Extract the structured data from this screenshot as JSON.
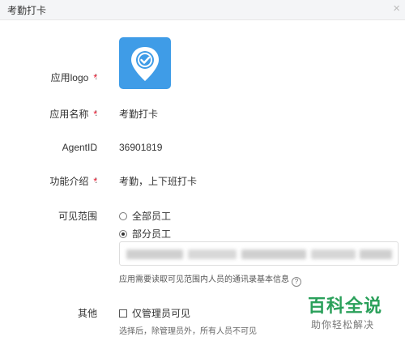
{
  "dialog": {
    "title": "考勤打卡",
    "close": "×"
  },
  "form": {
    "logo": {
      "label": "应用logo",
      "required": "*",
      "colon": ":"
    },
    "name": {
      "label": "应用名称",
      "required": "*",
      "colon": ":",
      "value": "考勤打卡"
    },
    "agent": {
      "label": "AgentID",
      "colon": ":",
      "value": "36901819"
    },
    "intro": {
      "label": "功能介绍",
      "required": "*",
      "colon": ":",
      "value": "考勤，上下班打卡"
    },
    "visible": {
      "label": "可见范围",
      "colon": ":",
      "options": [
        {
          "label": "全部员工",
          "selected": false
        },
        {
          "label": "部分员工",
          "selected": true
        }
      ],
      "hint": "应用需要读取可见范围内人员的通讯录基本信息",
      "hint_icon": "?"
    },
    "other": {
      "label": "其他",
      "colon": ":",
      "checkbox_label": "仅管理员可见",
      "checked": false,
      "hint": "选择后，除管理员外，所有人员不可见"
    }
  },
  "watermark": {
    "title": "百科全说",
    "subtitle": "助你轻松解决"
  },
  "colors": {
    "logo_bg": "#3f9ce7",
    "required": "#e6162d",
    "watermark": "#2aa05a"
  }
}
